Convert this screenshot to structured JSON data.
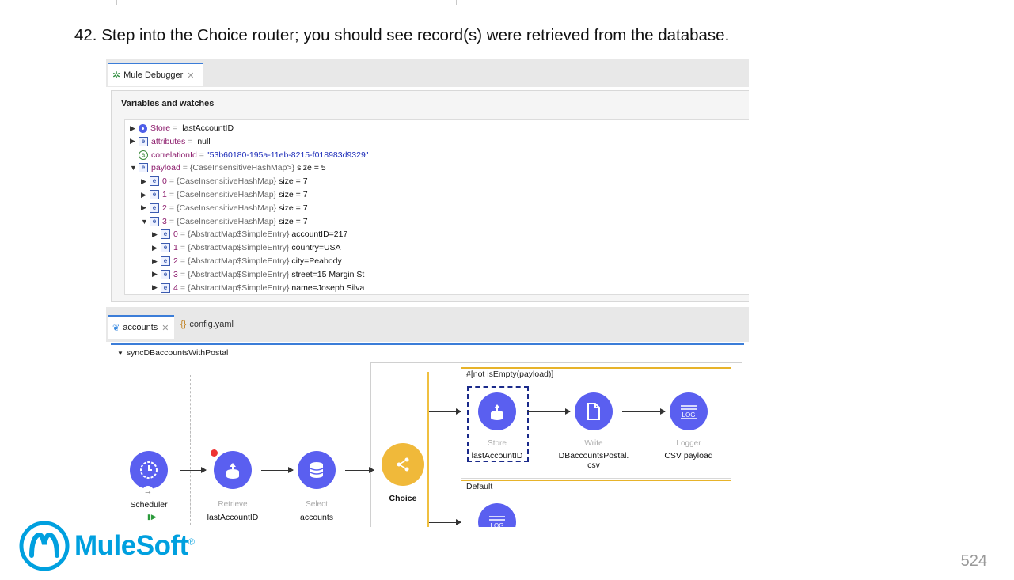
{
  "step_text": "42. Step into the Choice router; you should see record(s) were retrieved from the database.",
  "debugger": {
    "tab_label": "Mule Debugger",
    "panel_title": "Variables and watches",
    "rows": [
      {
        "indent": 0,
        "twisty": "▶",
        "icon": "circle",
        "name": "Store",
        "eq": "=",
        "type": "",
        "value": "lastAccountID",
        "value_class": "val"
      },
      {
        "indent": 0,
        "twisty": "▶",
        "icon": "e",
        "name": "attributes",
        "eq": "=",
        "type": "",
        "value": "null",
        "value_class": "val"
      },
      {
        "indent": 0,
        "twisty": "",
        "icon": "a",
        "name": "correlationId",
        "eq": "=",
        "type": "",
        "value": "\"53b60180-195a-11eb-8215-f018983d9329\"",
        "value_class": "str"
      },
      {
        "indent": 0,
        "twisty": "▼",
        "icon": "e",
        "name": "payload",
        "eq": "=",
        "type": "{CaseInsensitiveHashMap>}",
        "value": "size = 5",
        "value_class": "val"
      },
      {
        "indent": 1,
        "twisty": "▶",
        "icon": "e",
        "name": "0",
        "eq": "=",
        "type": "{CaseInsensitiveHashMap}",
        "value": "size = 7",
        "value_class": "val"
      },
      {
        "indent": 1,
        "twisty": "▶",
        "icon": "e",
        "name": "1",
        "eq": "=",
        "type": "{CaseInsensitiveHashMap}",
        "value": "size = 7",
        "value_class": "val"
      },
      {
        "indent": 1,
        "twisty": "▶",
        "icon": "e",
        "name": "2",
        "eq": "=",
        "type": "{CaseInsensitiveHashMap}",
        "value": "size = 7",
        "value_class": "val"
      },
      {
        "indent": 1,
        "twisty": "▼",
        "icon": "e",
        "name": "3",
        "eq": "=",
        "type": "{CaseInsensitiveHashMap}",
        "value": "size = 7",
        "value_class": "val"
      },
      {
        "indent": 2,
        "twisty": "▶",
        "icon": "e",
        "name": "0",
        "eq": "=",
        "type": "{AbstractMap$SimpleEntry}",
        "value": "accountID=217",
        "value_class": "val"
      },
      {
        "indent": 2,
        "twisty": "▶",
        "icon": "e",
        "name": "1",
        "eq": "=",
        "type": "{AbstractMap$SimpleEntry}",
        "value": "country=USA",
        "value_class": "val"
      },
      {
        "indent": 2,
        "twisty": "▶",
        "icon": "e",
        "name": "2",
        "eq": "=",
        "type": "{AbstractMap$SimpleEntry}",
        "value": "city=Peabody",
        "value_class": "val"
      },
      {
        "indent": 2,
        "twisty": "▶",
        "icon": "e",
        "name": "3",
        "eq": "=",
        "type": "{AbstractMap$SimpleEntry}",
        "value": "street=15 Margin St",
        "value_class": "val"
      },
      {
        "indent": 2,
        "twisty": "▶",
        "icon": "e",
        "name": "4",
        "eq": "=",
        "type": "{AbstractMap$SimpleEntry}",
        "value": "name=Joseph Silva",
        "value_class": "val"
      }
    ]
  },
  "editor": {
    "tab_accounts": "accounts",
    "tab_config": "config.yaml",
    "flow_name": "syncDBaccountsWithPostal",
    "scheduler": {
      "line1": "Scheduler"
    },
    "retrieve": {
      "line1": "Retrieve",
      "line2": "lastAccountID"
    },
    "select": {
      "line1": "Select",
      "line2": "accounts"
    },
    "choice": {
      "line1": "Choice"
    },
    "route1_label": "#[not isEmpty(payload)]",
    "route2_label": "Default",
    "store": {
      "line1": "Store",
      "line2": "lastAccountID"
    },
    "write": {
      "line1": "Write",
      "line2": "DBaccountsPostal.",
      "line3": "csv"
    },
    "logger": {
      "line1": "Logger",
      "line2": "CSV payload"
    },
    "log_text": "LOG"
  },
  "brand": {
    "name": "MuleSoft",
    "registered": "®",
    "color": "#00a0df"
  },
  "page_number": "524"
}
